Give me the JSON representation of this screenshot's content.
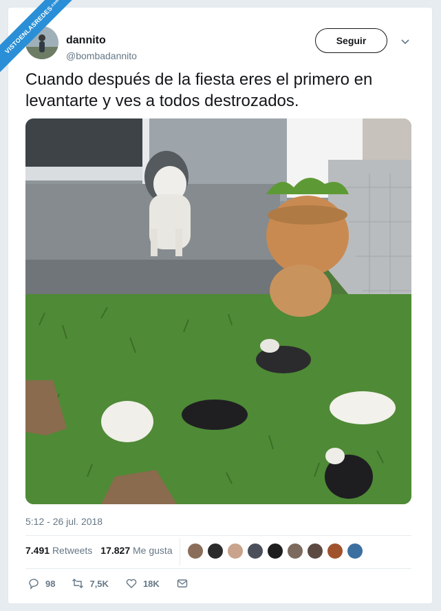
{
  "watermark": {
    "main": "VISTOENLASREDES",
    "suffix": ".com"
  },
  "author": {
    "name": "dannito",
    "handle": "@bombadannito"
  },
  "follow_label": "Seguir",
  "tweet_text": "Cuando después de la fiesta eres el primero en levantarte y ves a todos destrozados.",
  "timestamp": "5:12 - 26 jul. 2018",
  "stats": {
    "retweets_count": "7.491",
    "retweets_label": "Retweets",
    "likes_count": "17.827",
    "likes_label": "Me gusta"
  },
  "liker_avatar_colors": [
    "#8a6e5a",
    "#2b2b2b",
    "#c9a38b",
    "#4a4f5a",
    "#1e1e1e",
    "#7d6a5e",
    "#5c4a42",
    "#a0522d",
    "#3b6fa0"
  ],
  "actions": {
    "replies": "98",
    "retweets": "7,5K",
    "likes": "18K"
  },
  "colors": {
    "accent": "#1da1f2",
    "muted": "#657786",
    "watermark": "#2a8fd6"
  },
  "icons": [
    "chevron-down-icon",
    "reply-icon",
    "retweet-icon",
    "heart-icon",
    "direct-message-icon"
  ]
}
